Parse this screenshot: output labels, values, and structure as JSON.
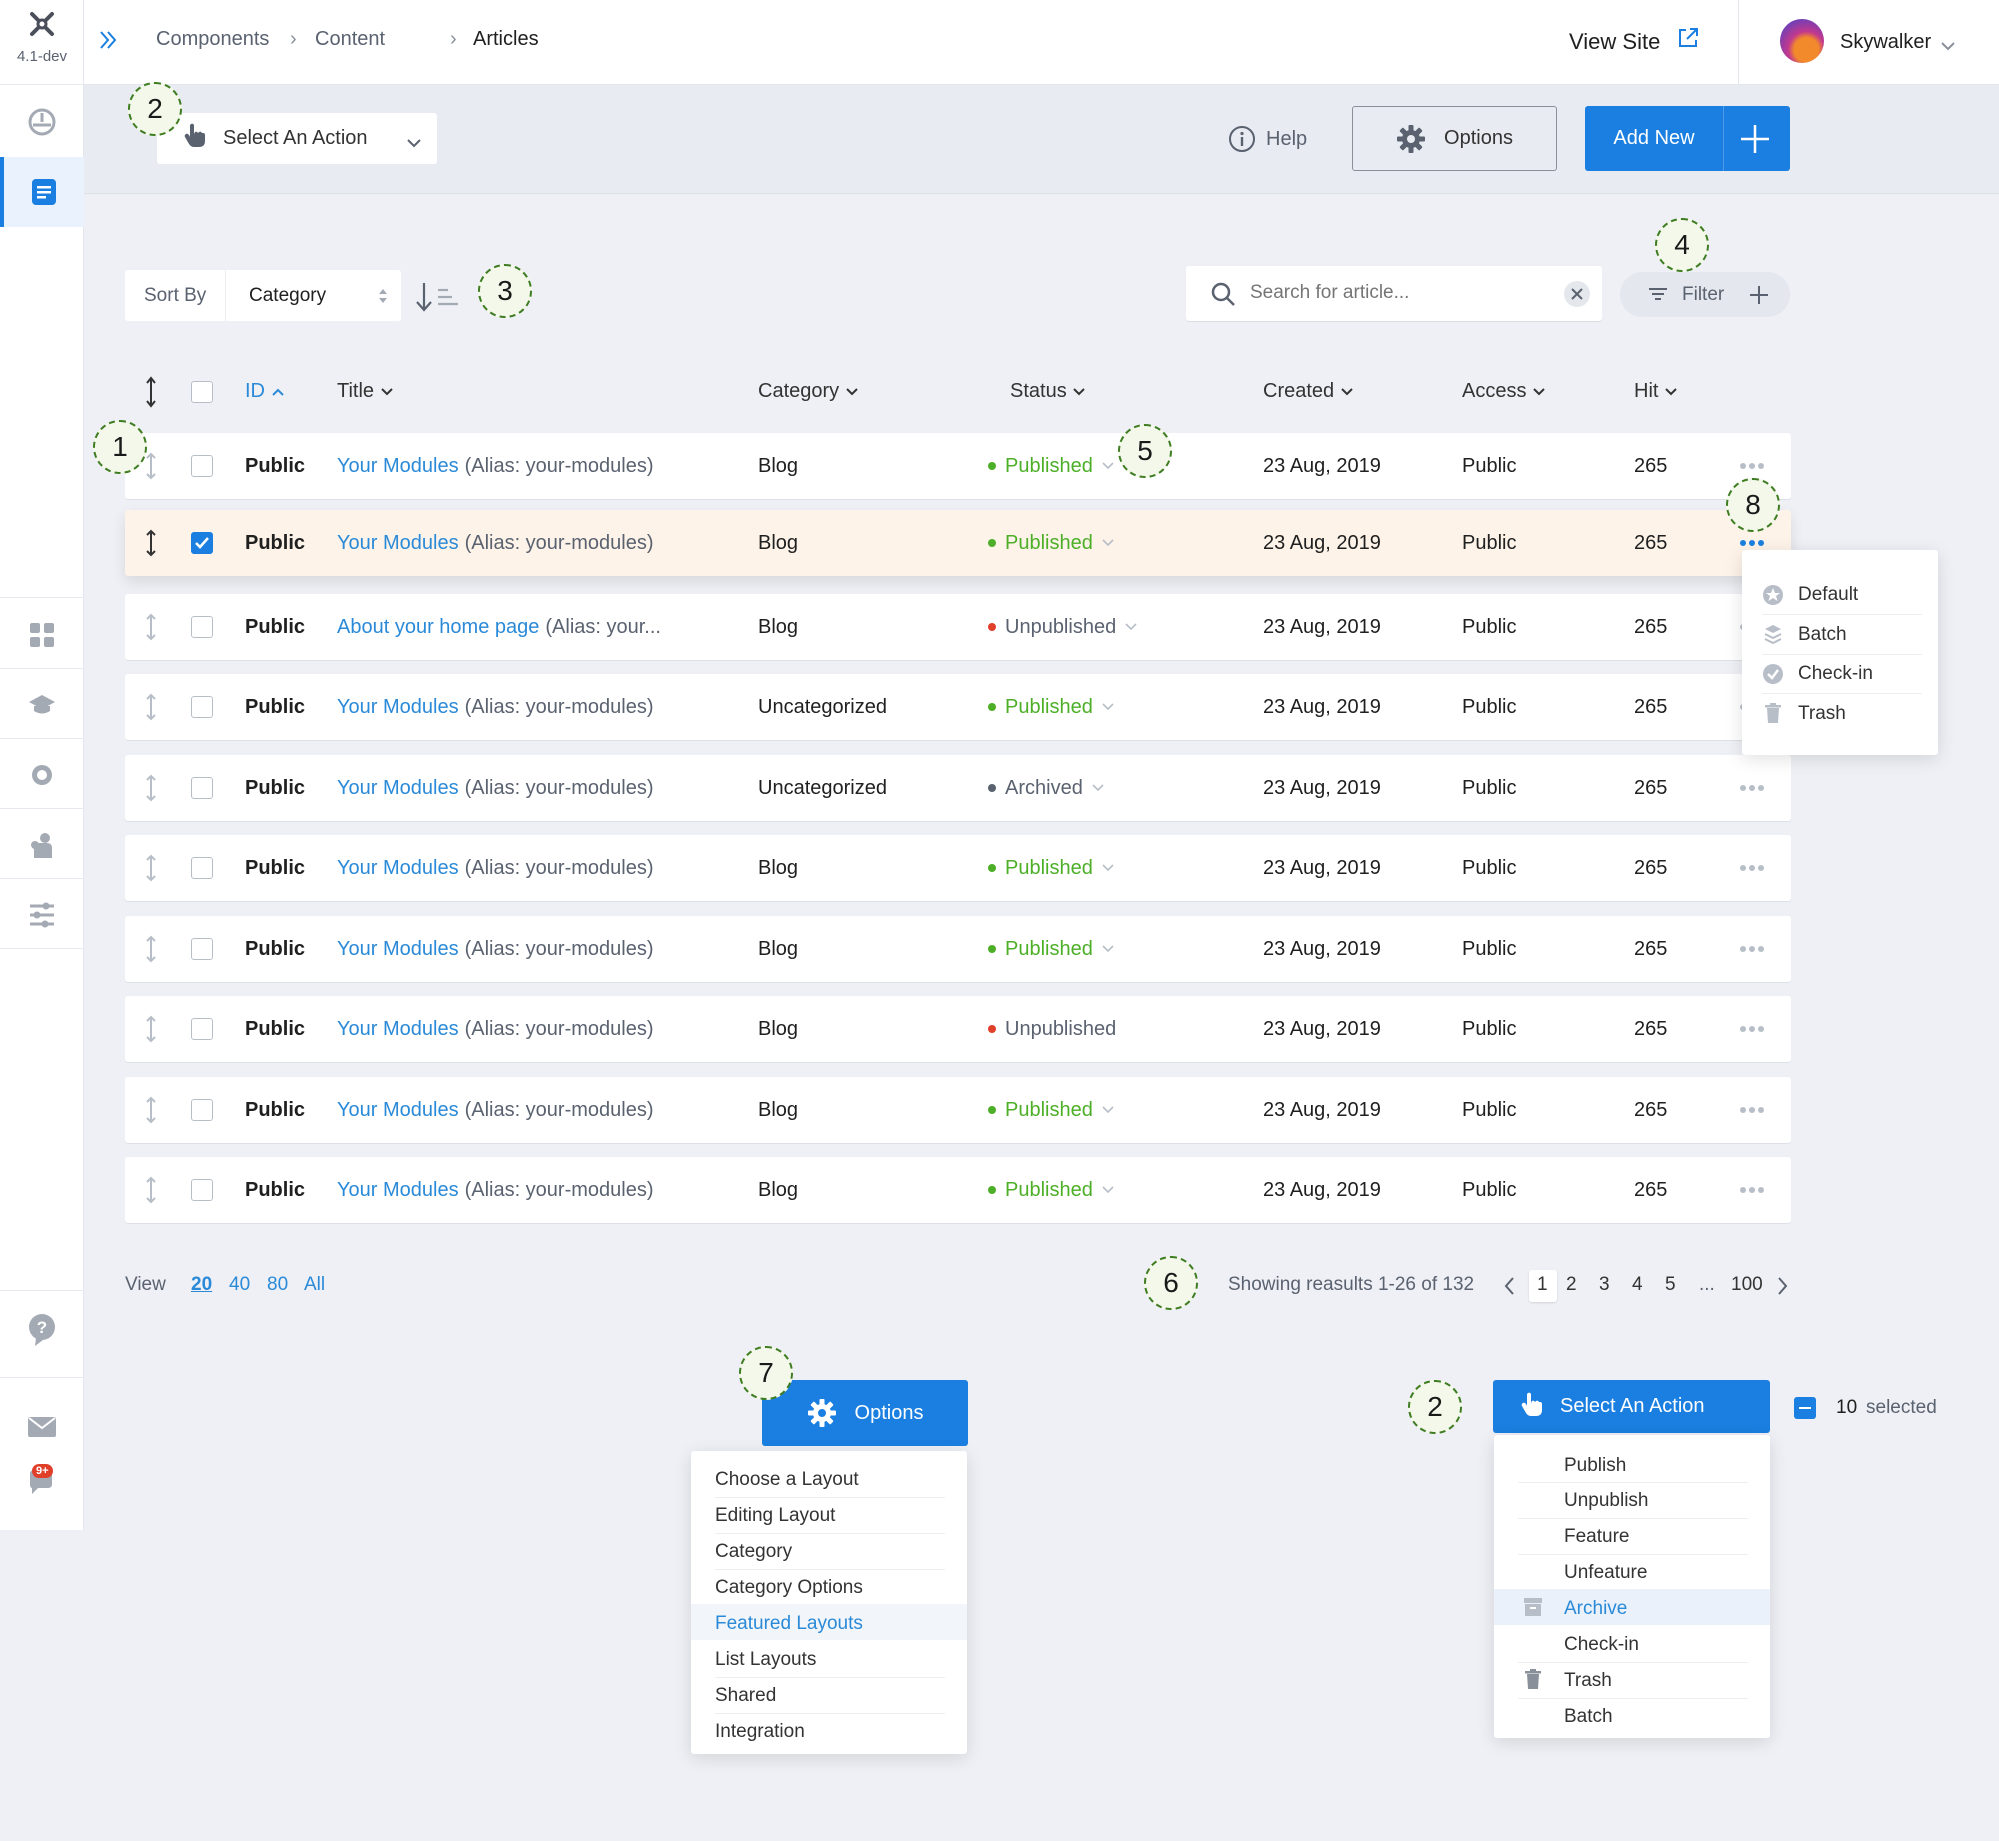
{
  "app": {
    "version": "4.1-dev"
  },
  "breadcrumb": [
    "Components",
    "Content",
    "Articles"
  ],
  "header": {
    "view_site": "View Site",
    "user": "Skywalker"
  },
  "toolbar": {
    "select_action": "Select An Action",
    "help": "Help",
    "options": "Options",
    "add_new": "Add New"
  },
  "sort": {
    "label": "Sort By",
    "value": "Category"
  },
  "search": {
    "placeholder": "Search for article..."
  },
  "filter": {
    "label": "Filter"
  },
  "columns": {
    "id": "ID",
    "title": "Title",
    "category": "Category",
    "status": "Status",
    "created": "Created",
    "access": "Access",
    "hit": "Hit"
  },
  "rows": [
    {
      "id": "Public",
      "title": "Your Modules",
      "alias": "(Alias: your-modules)",
      "category": "Blog",
      "status": "Published",
      "status_color": "#4caf27",
      "created": "23 Aug, 2019",
      "access": "Public",
      "hits": "265",
      "checked": false
    },
    {
      "id": "Public",
      "title": "Your Modules",
      "alias": "(Alias: your-modules)",
      "category": "Blog",
      "status": "Published",
      "status_color": "#4caf27",
      "created": "23 Aug, 2019",
      "access": "Public",
      "hits": "265",
      "checked": true
    },
    {
      "id": "Public",
      "title": "About your home page",
      "alias": "(Alias: your...",
      "category": "Blog",
      "status": "Unpublished",
      "status_color": "#e0402a",
      "created": "23 Aug, 2019",
      "access": "Public",
      "hits": "265",
      "checked": false
    },
    {
      "id": "Public",
      "title": "Your Modules",
      "alias": "(Alias: your-modules)",
      "category": "Uncategorized",
      "status": "Published",
      "status_color": "#4caf27",
      "created": "23 Aug, 2019",
      "access": "Public",
      "hits": "265",
      "checked": false
    },
    {
      "id": "Public",
      "title": "Your Modules",
      "alias": "(Alias: your-modules)",
      "category": "Uncategorized",
      "status": "Archived",
      "status_color": "#5a6270",
      "created": "23 Aug, 2019",
      "access": "Public",
      "hits": "265",
      "checked": false
    },
    {
      "id": "Public",
      "title": "Your Modules",
      "alias": "(Alias: your-modules)",
      "category": "Blog",
      "status": "Published",
      "status_color": "#4caf27",
      "created": "23 Aug, 2019",
      "access": "Public",
      "hits": "265",
      "checked": false
    },
    {
      "id": "Public",
      "title": "Your Modules",
      "alias": "(Alias: your-modules)",
      "category": "Blog",
      "status": "Published",
      "status_color": "#4caf27",
      "created": "23 Aug, 2019",
      "access": "Public",
      "hits": "265",
      "checked": false
    },
    {
      "id": "Public",
      "title": "Your Modules",
      "alias": "(Alias: your-modules)",
      "category": "Blog",
      "status": "Unpublished",
      "status_color": "#e0402a",
      "created": "23 Aug, 2019",
      "access": "Public",
      "hits": "265",
      "checked": false
    },
    {
      "id": "Public",
      "title": "Your Modules",
      "alias": "(Alias: your-modules)",
      "category": "Blog",
      "status": "Published",
      "status_color": "#4caf27",
      "created": "23 Aug, 2019",
      "access": "Public",
      "hits": "265",
      "checked": false
    },
    {
      "id": "Public",
      "title": "Your Modules",
      "alias": "(Alias: your-modules)",
      "category": "Blog",
      "status": "Published",
      "status_color": "#4caf27",
      "created": "23 Aug, 2019",
      "access": "Public",
      "hits": "265",
      "checked": false
    }
  ],
  "row_menu": [
    "Default",
    "Batch",
    "Check-in",
    "Trash"
  ],
  "pagination": {
    "view_label": "View",
    "sizes": [
      "20",
      "40",
      "80",
      "All"
    ],
    "showing": "Showing reasults 1-26 of 132",
    "pages": [
      "1",
      "2",
      "3",
      "4",
      "5",
      "...",
      "100"
    ]
  },
  "options_menu": {
    "button": "Options",
    "items": [
      "Choose a Layout",
      "Editing Layout",
      "Category",
      "Category Options",
      "Featured Layouts",
      "List Layouts",
      "Shared",
      "Integration"
    ]
  },
  "action_menu": {
    "button": "Select An Action",
    "selected_count": "10",
    "selected_label": "selected",
    "items": [
      "Publish",
      "Unpublish",
      "Feature",
      "Unfeature",
      "Archive",
      "Check-in",
      "Trash",
      "Batch"
    ]
  },
  "annotations": [
    "1",
    "2",
    "3",
    "4",
    "5",
    "6",
    "7",
    "8",
    "2"
  ],
  "notifications": {
    "badge": "9+"
  },
  "colors": {
    "primary": "#1a7fe0",
    "link": "#2a8ad8",
    "published": "#4caf27",
    "unpublished": "#e0402a",
    "archived": "#5a6270",
    "annotation": "#3f7d22"
  }
}
